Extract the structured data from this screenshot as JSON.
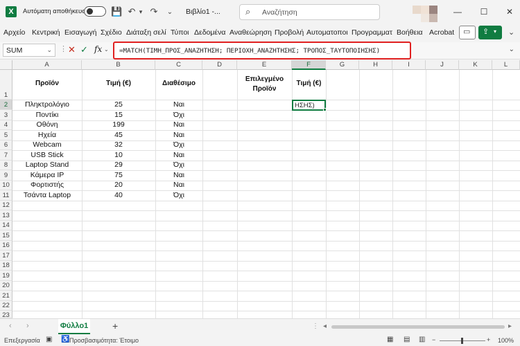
{
  "titlebar": {
    "app_icon_letter": "X",
    "autosave_label": "Αυτόματη αποθήκευση",
    "doc_title": "Βιβλίο1 -...",
    "search_placeholder": "Αναζήτηση"
  },
  "ribbon": {
    "tabs": [
      "Αρχείο",
      "Κεντρική",
      "Εισαγωγή",
      "Σχέδιο",
      "Διάταξη σελί",
      "Τύποι",
      "Δεδομένα",
      "Αναθεώρηση",
      "Προβολή",
      "Αυτοματοποι",
      "Προγραμματ",
      "Βοήθεια",
      "Acrobat"
    ]
  },
  "formula_bar": {
    "name_box": "SUM",
    "fx_label": "fx",
    "formula": "=MATCH(ΤΙΜΗ_ΠΡΟΣ_ΑΝΑΖΗΤΗΣΗ; ΠΕΡΙΟΧΗ_ΑΝΑΖΗΤΗΣΗΣ; ΤΡΟΠΟΣ_ΤΑΥΤΟΠΟΙΗΣΗΣ)"
  },
  "grid": {
    "columns": [
      "A",
      "B",
      "C",
      "D",
      "E",
      "F",
      "G",
      "H",
      "I",
      "J",
      "K",
      "L"
    ],
    "rows": [
      "1",
      "2",
      "3",
      "4",
      "5",
      "6",
      "7",
      "8",
      "9",
      "10",
      "11",
      "12",
      "13",
      "14",
      "15",
      "16",
      "17",
      "18",
      "19",
      "20",
      "21",
      "22",
      "23"
    ],
    "headers": {
      "A1": "Προϊόν",
      "B1": "Τιμή (€)",
      "C1": "Διαθέσιμο",
      "E1_line1": "Επιλεγμένο",
      "E1_line2": "Προϊόν",
      "F1": "Τιμή (€)"
    },
    "data": [
      [
        "Πληκτρολόγιο",
        "25",
        "Ναι"
      ],
      [
        "Ποντίκι",
        "15",
        "Όχι"
      ],
      [
        "Οθόνη",
        "199",
        "Ναι"
      ],
      [
        "Ηχεία",
        "45",
        "Ναι"
      ],
      [
        "Webcam",
        "32",
        "Όχι"
      ],
      [
        "USB Stick",
        "10",
        "Ναι"
      ],
      [
        "Laptop Stand",
        "29",
        "Όχι"
      ],
      [
        "Κάμερα IP",
        "75",
        "Ναι"
      ],
      [
        "Φορτιστής",
        "20",
        "Ναι"
      ],
      [
        "Τσάντα Laptop",
        "40",
        "Όχι"
      ]
    ],
    "active_cell_text": "ΗΣΗΣ)"
  },
  "sheets": {
    "active": "Φύλλο1"
  },
  "status": {
    "mode": "Επεξεργασία",
    "accessibility": "Προσβασιμότητα: Έτοιμο",
    "zoom": "100%"
  },
  "colors": {
    "accent": "#107c41",
    "highlight_border": "#e02020"
  }
}
